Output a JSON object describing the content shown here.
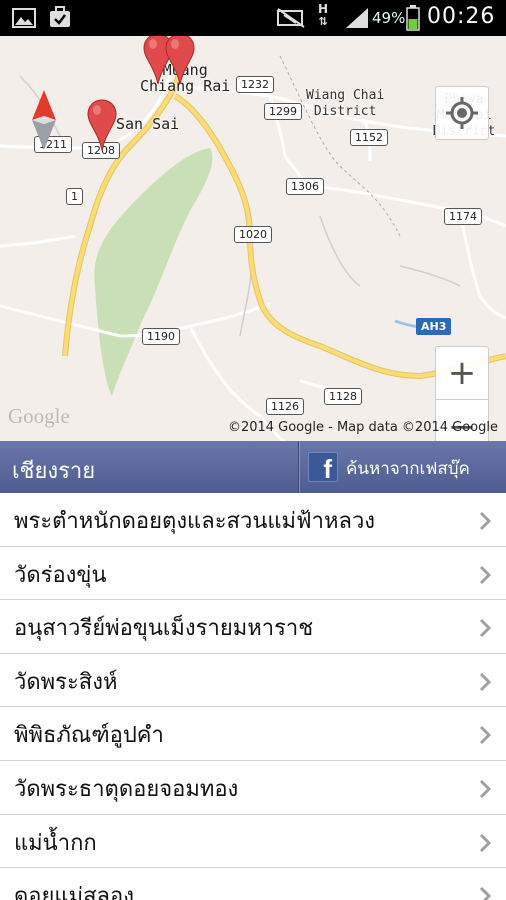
{
  "status_bar": {
    "battery_percent": "49%",
    "time": "00:26",
    "network": "H",
    "icons": [
      "gallery-icon",
      "task-icon",
      "mute-icon",
      "network-h-icon",
      "signal-icon",
      "battery-icon"
    ]
  },
  "map": {
    "places": [
      {
        "name": "Muang\nChiang Rai"
      },
      {
        "name": "San Sai"
      },
      {
        "name": "Wiang Chai\nDistrict"
      },
      {
        "name": "Phaya Mengrai\nDistrict"
      }
    ],
    "roads": [
      "1232",
      "1299",
      "1211",
      "1208",
      "1",
      "1152",
      "1306",
      "1174",
      "1020",
      "1190",
      "AH3",
      "1128",
      "1126"
    ],
    "logo": "Google",
    "attribution": "©2014 Google - Map data ©2014 Google",
    "zoom_in": "+",
    "zoom_out": "−",
    "colors": {
      "land": "#f4eeea",
      "park": "#c9dfb5",
      "highway": "#f5d76e",
      "pin": "#e04a4a"
    }
  },
  "header": {
    "title": "เชียงราย",
    "facebook_label": "ค้นหาจากเฟสบุ๊ค",
    "facebook_glyph": "f",
    "colors": {
      "bar": "#5a67a0",
      "facebook": "#3b5998"
    }
  },
  "list": {
    "items": [
      {
        "label": "พระตำหนักดอยตุงและสวนแม่ฟ้าหลวง"
      },
      {
        "label": "วัดร่องขุ่น"
      },
      {
        "label": "อนุสาวรีย์พ่อขุนเม็งรายมหาราช"
      },
      {
        "label": "วัดพระสิงห์"
      },
      {
        "label": "พิพิธภัณฑ์อูปคำ"
      },
      {
        "label": "วัดพระธาตุดอยจอมทอง"
      },
      {
        "label": "แม่น้ำกก"
      },
      {
        "label": "ดอยแม่สลอง"
      }
    ]
  }
}
